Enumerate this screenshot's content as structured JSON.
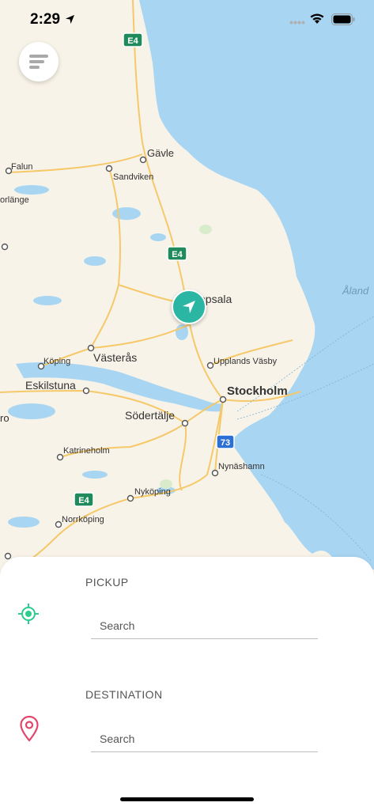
{
  "status": {
    "time": "2:29"
  },
  "map": {
    "places": [
      {
        "name": "Gävle"
      },
      {
        "name": "Falun"
      },
      {
        "name": "Sandviken"
      },
      {
        "name": "orlänge"
      },
      {
        "name": "ppsala"
      },
      {
        "name": "Västerås"
      },
      {
        "name": "Köping"
      },
      {
        "name": "Upplands Väsby"
      },
      {
        "name": "Eskilstuna"
      },
      {
        "name": "Stockholm"
      },
      {
        "name": "ro"
      },
      {
        "name": "Södertälje"
      },
      {
        "name": "Katrineholm"
      },
      {
        "name": "Nynäshamn"
      },
      {
        "name": "Nyköping"
      },
      {
        "name": "Norrköping"
      },
      {
        "name": "Åland"
      }
    ],
    "shields": [
      {
        "label": "E4"
      },
      {
        "label": "E4"
      },
      {
        "label": "E4"
      },
      {
        "label": "73"
      }
    ],
    "colors": {
      "water": "#a8d5f2",
      "land": "#f8f3e8",
      "road": "#f5c96a",
      "teal": "#2bb5a3",
      "pink": "#e2456a"
    }
  },
  "panel": {
    "pickup": {
      "label": "PICKUP",
      "placeholder": "Search",
      "icon": "crosshair-icon"
    },
    "destination": {
      "label": "DESTINATION",
      "placeholder": "Search",
      "icon": "map-pin-icon"
    }
  }
}
